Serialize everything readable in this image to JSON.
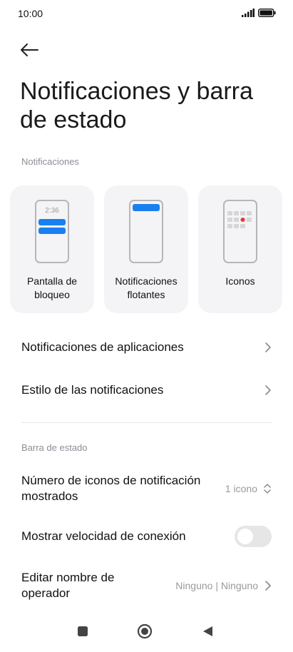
{
  "status_bar": {
    "time": "10:00",
    "icons": [
      "signal-icon",
      "battery-icon"
    ]
  },
  "header": {
    "back_icon": "arrow-left-icon",
    "title": "Notificaciones y barra de estado"
  },
  "notifications_section": {
    "label": "Notificaciones",
    "cards": [
      {
        "name": "lock-screen",
        "label": "Pantalla de bloqueo",
        "preview_time": "2:36"
      },
      {
        "name": "floating",
        "label": "Notificaciones flotantes"
      },
      {
        "name": "icons",
        "label": "Iconos"
      }
    ],
    "rows": [
      {
        "label": "Notificaciones de aplicaciones"
      },
      {
        "label": "Estilo de las notificaciones"
      }
    ]
  },
  "status_bar_section": {
    "label": "Barra de estado",
    "icon_count": {
      "label": "Número de iconos de notificación mostrados",
      "value": "1 icono"
    },
    "connection_speed": {
      "label": "Mostrar velocidad de conexión",
      "enabled": false
    },
    "carrier_name": {
      "label": "Editar nombre de operador",
      "value": "Ninguno | Ninguno"
    }
  },
  "navbar": {
    "buttons": [
      "recents-icon",
      "home-icon",
      "back-triangle-icon"
    ]
  },
  "colors": {
    "accent": "#1a7ff0",
    "dot": "#e53935",
    "toggle_off": "#e6e6e6",
    "muted": "#8a8f97"
  }
}
